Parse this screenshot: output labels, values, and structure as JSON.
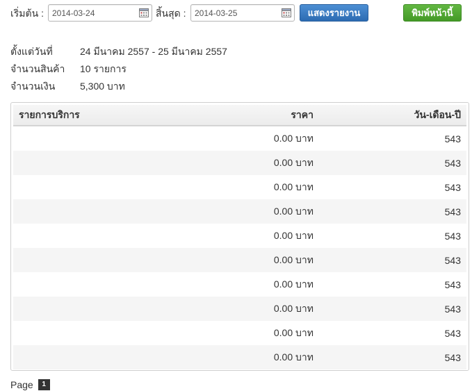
{
  "filter": {
    "start_label": "เริ่มต้น :",
    "start_value": "2014-03-24",
    "end_label": "สิ้นสุด :",
    "end_value": "2014-03-25",
    "show_report_button": "แสดงรายงาน",
    "print_button": "พิมพ์หน้านี้"
  },
  "summary": {
    "range_label": "ตั้งแต่วันที่",
    "range_value": "24 มีนาคม 2557 - 25 มีนาคม 2557",
    "items_label": "จำนวนสินค้า",
    "items_value": "10 รายการ",
    "amount_label": "จำนวนเงิน",
    "amount_value": "5,300 บาท"
  },
  "table": {
    "headers": {
      "service": "รายการบริการ",
      "price": "ราคา",
      "date": "วัน-เดือน-ปี"
    },
    "rows": [
      {
        "service": "",
        "price": "0.00 บาท",
        "date": "543"
      },
      {
        "service": "",
        "price": "0.00 บาท",
        "date": "543"
      },
      {
        "service": "",
        "price": "0.00 บาท",
        "date": "543"
      },
      {
        "service": "",
        "price": "0.00 บาท",
        "date": "543"
      },
      {
        "service": "",
        "price": "0.00 บาท",
        "date": "543"
      },
      {
        "service": "",
        "price": "0.00 บาท",
        "date": "543"
      },
      {
        "service": "",
        "price": "0.00 บาท",
        "date": "543"
      },
      {
        "service": "",
        "price": "0.00 บาท",
        "date": "543"
      },
      {
        "service": "",
        "price": "0.00 บาท",
        "date": "543"
      },
      {
        "service": "",
        "price": "0.00 บาท",
        "date": "543"
      }
    ]
  },
  "pagination": {
    "label": "Page",
    "current_page": "1"
  },
  "icons": {
    "date_picker": "calendar-icon"
  }
}
